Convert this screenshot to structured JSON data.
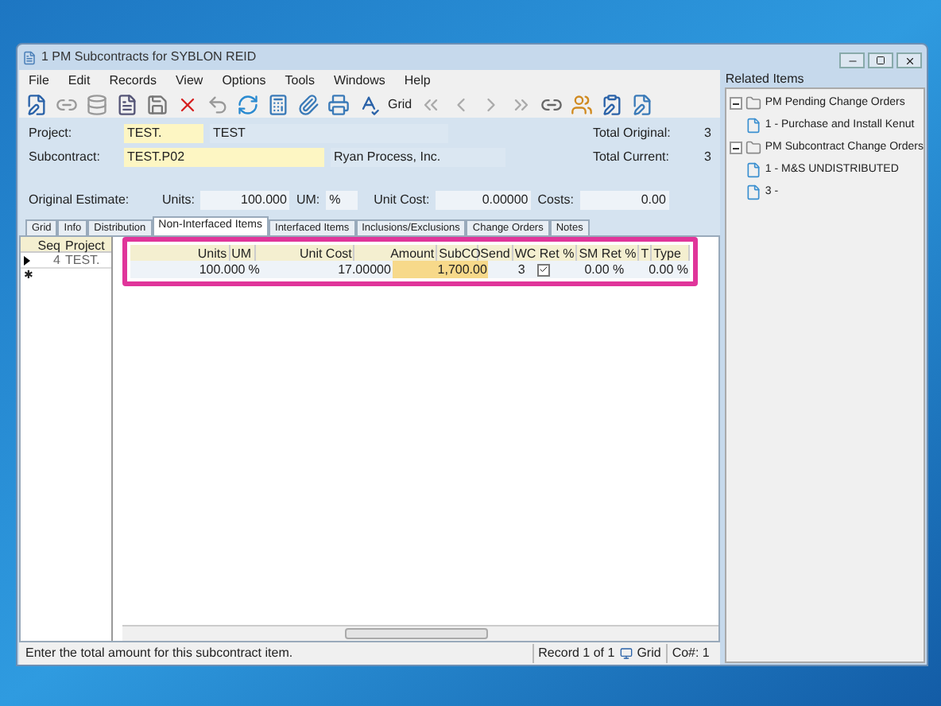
{
  "window": {
    "title": "1 PM Subcontracts for SYBLON REID"
  },
  "menu": [
    "File",
    "Edit",
    "Records",
    "View",
    "Options",
    "Tools",
    "Windows",
    "Help"
  ],
  "toolbar": {
    "view_label": "Grid"
  },
  "header": {
    "project_label": "Project:",
    "project_code": "TEST.",
    "project_name": "TEST",
    "subcontract_label": "Subcontract:",
    "subcontract_code": "TEST.P02",
    "vendor": "Ryan Process, Inc.",
    "total_original_label": "Total Original:",
    "total_original": "3",
    "total_current_label": "Total Current:",
    "total_current": "3"
  },
  "estimate": {
    "label": "Original Estimate:",
    "units_label": "Units:",
    "units": "100.000",
    "um_label": "UM:",
    "um": "%",
    "unit_cost_label": "Unit Cost:",
    "unit_cost": "0.00000",
    "costs_label": "Costs:",
    "costs": "0.00"
  },
  "tabs": [
    {
      "label": "Grid",
      "selected": false
    },
    {
      "label": "Info",
      "selected": false
    },
    {
      "label": "Distribution",
      "selected": false
    },
    {
      "label": "Non-Interfaced Items",
      "selected": true
    },
    {
      "label": "Interfaced Items",
      "selected": false
    },
    {
      "label": "Inclusions/Exclusions",
      "selected": false
    },
    {
      "label": "Change Orders",
      "selected": false
    },
    {
      "label": "Notes",
      "selected": false
    }
  ],
  "left_grid": {
    "columns": [
      "Seq",
      "Project"
    ],
    "rows": [
      {
        "cells": [
          "4",
          "TEST."
        ],
        "current": true
      }
    ],
    "new_row_marker": "✱"
  },
  "grid": {
    "columns": [
      "Units",
      "UM",
      "Unit Cost",
      "Amount",
      "SubCO",
      "Send",
      "WC Ret %",
      "SM Ret %",
      "T",
      "Type"
    ],
    "rows": [
      {
        "units": "100.000",
        "um": "%",
        "unit_cost": "17.00000",
        "amount": "1,700.00",
        "subco": "3",
        "send": true,
        "wc_ret": "0.00 %",
        "sm_ret": "0.00 %"
      }
    ]
  },
  "related": {
    "title": "Related Items",
    "tree": [
      {
        "label": "PM Pending Change Orders",
        "expanded": true,
        "children": [
          {
            "label": "1 - Purchase and Install Kenut"
          }
        ]
      },
      {
        "label": "PM Subcontract Change Orders",
        "expanded": true,
        "children": [
          {
            "label": "1 - M&S UNDISTRIBUTED"
          },
          {
            "label": "3 -"
          }
        ]
      }
    ]
  },
  "status_bar": {
    "message": "Enter the total amount for this subcontract item.",
    "record": "Record 1 of 1",
    "view": "Grid",
    "company": "Co#: 1"
  }
}
